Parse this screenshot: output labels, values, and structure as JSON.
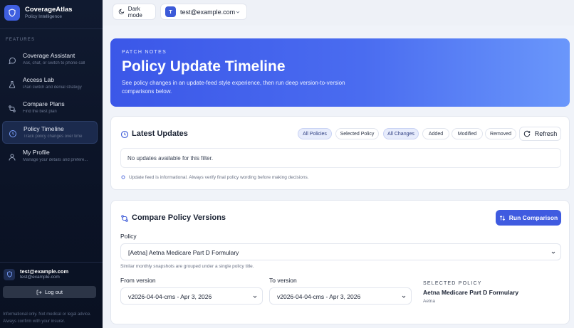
{
  "brand": {
    "name": "CoverageAtlas",
    "tagline": "Policy Intelligence"
  },
  "sidebar": {
    "section_label": "FEATURES",
    "items": [
      {
        "title": "Coverage Assistant",
        "subtitle": "Ask, chat, or switch to phone call",
        "icon": "chat-bubble-icon",
        "active": false
      },
      {
        "title": "Access Lab",
        "subtitle": "Plan switch and denial strategy",
        "icon": "flask-icon",
        "active": false
      },
      {
        "title": "Compare Plans",
        "subtitle": "Find the best plan",
        "icon": "compare-arrows-icon",
        "active": false
      },
      {
        "title": "Policy Timeline",
        "subtitle": "Track policy changes over time",
        "icon": "clock-icon",
        "active": true
      },
      {
        "title": "My Profile",
        "subtitle": "Manage your details and prefere...",
        "icon": "user-icon",
        "active": false
      }
    ],
    "user": {
      "email": "test@example.com",
      "email_secondary": "test@example.com"
    },
    "logout_label": "Log out",
    "disclaimer": "Informational only. Not medical or legal advice. Always confirm with your insurer."
  },
  "topbar": {
    "dark_mode_label": "Dark mode",
    "account_initial": "T",
    "account_email": "test@example.com"
  },
  "hero": {
    "kicker": "PATCH NOTES",
    "title": "Policy Update Timeline",
    "description": "See policy changes in an update-feed style experience, then run deep version-to-version comparisons below."
  },
  "updates": {
    "title": "Latest Updates",
    "scope_filters": [
      {
        "label": "All Policies",
        "selected": true
      },
      {
        "label": "Selected Policy",
        "selected": false
      }
    ],
    "change_filters": [
      {
        "label": "All Changes",
        "selected": true
      },
      {
        "label": "Added",
        "selected": false
      },
      {
        "label": "Modified",
        "selected": false
      },
      {
        "label": "Removed",
        "selected": false
      }
    ],
    "refresh_label": "Refresh",
    "empty_message": "No updates available for this filter.",
    "note": "Update feed is informational. Always verify final policy wording before making decisions."
  },
  "compare": {
    "title": "Compare Policy Versions",
    "run_label": "Run Comparison",
    "policy_label": "Policy",
    "policy_value": "[Aetna] Aetna Medicare Part D Formulary",
    "policy_hint": "Similar monthly snapshots are grouped under a single policy title.",
    "from_label": "From version",
    "from_value": "v2026-04-04-cms - Apr 3, 2026",
    "to_label": "To version",
    "to_value": "v2026-04-04-cms - Apr 3, 2026",
    "selected_kicker": "SELECTED POLICY",
    "selected_title": "Aetna Medicare Part D Formulary",
    "selected_payer": "Aetna"
  },
  "colors": {
    "accent": "#3f5be0",
    "sidebar_bg": "#0b1326",
    "hero_start": "#3b57e8",
    "hero_end": "#6a97fb"
  }
}
